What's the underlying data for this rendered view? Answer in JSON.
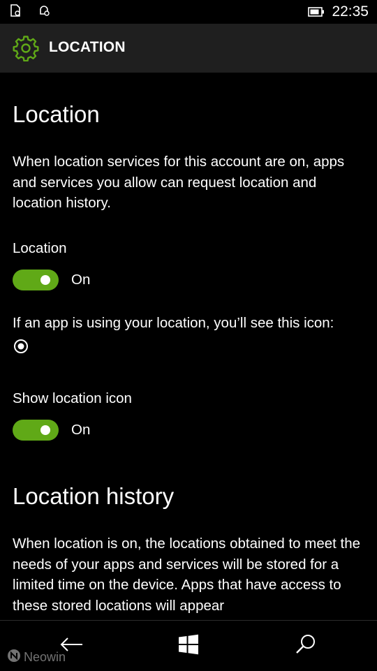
{
  "status_bar": {
    "time": "22:35",
    "icons": [
      "notification-icon",
      "quiet-hours-icon",
      "battery-icon"
    ]
  },
  "title_bar": {
    "icon": "gear-icon",
    "title": "LOCATION"
  },
  "section_location": {
    "heading": "Location",
    "description": "When location services for this account are on, apps and services you allow can request location and location history.",
    "toggle_label": "Location",
    "toggle_state": "On",
    "icon_note": "If an app is using your location, you’ll see this icon:",
    "icon_name": "location-in-use-icon"
  },
  "section_icon": {
    "toggle_label": "Show location icon",
    "toggle_state": "On"
  },
  "section_history": {
    "heading": "Location history",
    "description": "When location is on, the locations obtained to meet the needs of your apps and services will be stored for a limited time on the device. Apps that have access to these stored locations will appear"
  },
  "nav_bar": {
    "back_icon": "back-arrow-icon",
    "start_icon": "windows-start-icon",
    "search_icon": "search-icon"
  },
  "watermark": {
    "text": "Neowin"
  },
  "colors": {
    "accent": "#60a917",
    "background": "#000000",
    "title_bar": "#1f1f1f"
  }
}
